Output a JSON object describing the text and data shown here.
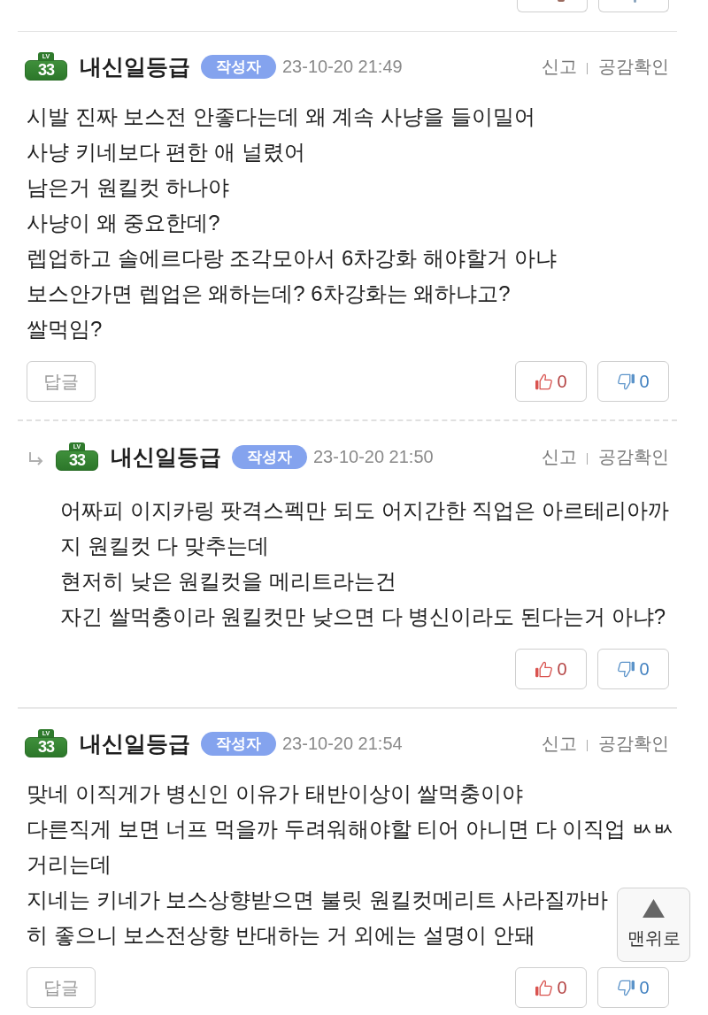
{
  "top_cut_buttons": [
    {
      "kind": "like"
    },
    {
      "kind": "dislike"
    }
  ],
  "comments": [
    {
      "kind": "comment",
      "rank_label": "LV",
      "rank": "33",
      "name": "내신일등급",
      "badge": "작성자",
      "time": "23-10-20 21:49",
      "actions": [
        {
          "kind": "report",
          "label": "신고"
        },
        {
          "kind": "likes",
          "label": "공감확인"
        }
      ],
      "lines": [
        "시발 진짜 보스전 안좋다는데 왜 계속 사냥을 들이밀어",
        "사냥 키네보다 편한 애 널렸어",
        "남은거 원킬컷 하나야",
        "사냥이 왜 중요한데?",
        "렙업하고 솔에르다랑 조각모아서 6차강화 해야할거 아냐",
        "보스안가면 렙업은 왜하는데? 6차강화는 왜하냐고?",
        "쌀먹임?"
      ],
      "reply_button": "답글",
      "likes": "0",
      "dislikes": "0"
    },
    {
      "kind": "reply",
      "rank_label": "LV",
      "rank": "33",
      "name": "내신일등급",
      "badge": "작성자",
      "time": "23-10-20 21:50",
      "actions": [
        {
          "kind": "report",
          "label": "신고"
        },
        {
          "kind": "likes",
          "label": "공감확인"
        }
      ],
      "lines": [
        "어짜피 이지카링 팟격스펙만 되도 어지간한 직업은 아르테리아까",
        "지 원킬컷 다 맞추는데",
        "현저히 낮은 원킬컷을 메리트라는건",
        "자긴 쌀먹충이라 원킬컷만 낮으면 다 병신이라도 된다는거 아냐?"
      ],
      "likes": "0",
      "dislikes": "0"
    },
    {
      "kind": "comment",
      "rank_label": "LV",
      "rank": "33",
      "name": "내신일등급",
      "badge": "작성자",
      "time": "23-10-20 21:54",
      "actions": [
        {
          "kind": "report",
          "label": "신고"
        },
        {
          "kind": "likes",
          "label": "공감확인"
        }
      ],
      "lines": [
        "맞네 이직게가 병신인 이유가 태반이상이 쌀먹충이야",
        "다른직게 보면 너프 먹을까 두려워해야할 티어 아니면 다 이직업 ㅄㅄ",
        "거리는데",
        "지네는 키네가 보스상향받으면 불릿 원킬컷메리트 사라질까바",
        "히 좋으니 보스전상향 반대하는 거 외에는 설명이 안돼"
      ],
      "reply_button": "답글",
      "likes": "0",
      "dislikes": "0"
    }
  ],
  "scroll_top_button": {
    "label": "맨위로"
  }
}
